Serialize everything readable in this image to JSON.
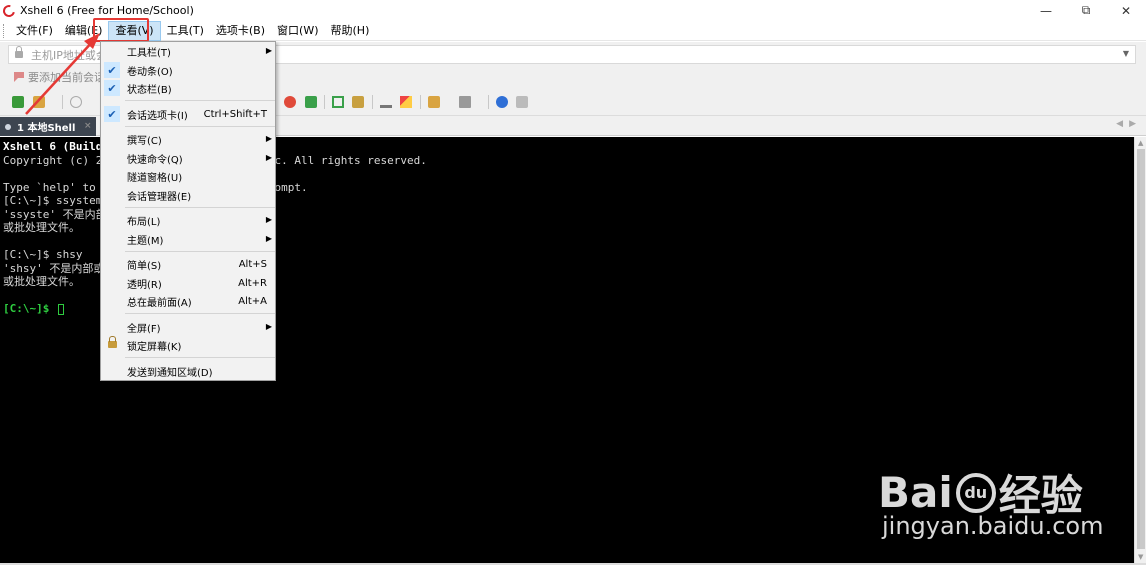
{
  "window": {
    "title": "Xshell 6 (Free for Home/School)",
    "controls": {
      "minimize": "—",
      "maximize": "⧉",
      "close": "✕"
    }
  },
  "menubar": {
    "items": [
      {
        "label": "文件(F)",
        "active": false
      },
      {
        "label": "编辑(E)",
        "active": false
      },
      {
        "label": "查看(V)",
        "active": true
      },
      {
        "label": "工具(T)",
        "active": false
      },
      {
        "label": "选项卡(B)",
        "active": false
      },
      {
        "label": "窗口(W)",
        "active": false
      },
      {
        "label": "帮助(H)",
        "active": false
      }
    ]
  },
  "addressbar": {
    "placeholder": "主机IP地址或会话名称",
    "dropdown_glyph": "▼"
  },
  "hintbar": {
    "text": "要添加当前会话，点击左侧的箭头按钮。"
  },
  "tab": {
    "label": "1 本地Shell",
    "close_glyph": "×",
    "nav_glyph": "◀▶"
  },
  "terminal": {
    "lines": [
      "Xshell 6 (Build 0197)",
      "Copyright (c) 2002 NetSarang Computer, Inc. All rights reserved.",
      "",
      "Type `help' to learn how to use Xshell prompt.",
      "[C:\\~]$ ssystem",
      "'ssyste' 不是内部或外部命令，也不是可运行的程序",
      "或批处理文件。",
      "",
      "[C:\\~]$ shsy",
      "'shsy' 不是内部或外部命令，也不是可运行的程序",
      "或批处理文件。",
      "",
      "[C:\\~]$ "
    ]
  },
  "view_menu": {
    "items": [
      {
        "label": "工具栏(T)",
        "shortcut": "",
        "submenu": true,
        "checked": false
      },
      {
        "label": "卷动条(O)",
        "shortcut": "",
        "submenu": false,
        "checked": true
      },
      {
        "label": "状态栏(B)",
        "shortcut": "",
        "submenu": false,
        "checked": true
      },
      {
        "label": "会话选项卡(I)",
        "shortcut": "Ctrl+Shift+T",
        "submenu": false,
        "checked": true
      },
      {
        "label": "撰写(C)",
        "shortcut": "",
        "submenu": true,
        "checked": false
      },
      {
        "label": "快速命令(Q)",
        "shortcut": "",
        "submenu": true,
        "checked": false
      },
      {
        "label": "隧道窗格(U)",
        "shortcut": "",
        "submenu": false,
        "checked": false
      },
      {
        "label": "会话管理器(E)",
        "shortcut": "",
        "submenu": false,
        "checked": false
      },
      {
        "label": "布局(L)",
        "shortcut": "",
        "submenu": true,
        "checked": false
      },
      {
        "label": "主题(M)",
        "shortcut": "",
        "submenu": true,
        "checked": false
      },
      {
        "label": "简单(S)",
        "shortcut": "Alt+S",
        "submenu": false,
        "checked": false
      },
      {
        "label": "透明(R)",
        "shortcut": "Alt+R",
        "submenu": false,
        "checked": false
      },
      {
        "label": "总在最前面(A)",
        "shortcut": "Alt+A",
        "submenu": false,
        "checked": false
      },
      {
        "label": "全屏(F)",
        "shortcut": "",
        "submenu": true,
        "checked": false
      },
      {
        "label": "锁定屏幕(K)",
        "shortcut": "",
        "submenu": false,
        "checked": false
      },
      {
        "label": "发送到通知区域(D)",
        "shortcut": "",
        "submenu": false,
        "checked": false
      }
    ],
    "check_glyph": "✔",
    "arrow_glyph": "▶"
  },
  "watermark": {
    "brand_left": "Bai",
    "brand_paw": "du",
    "brand_right": "经验",
    "url": "jingyan.baidu.com"
  },
  "colors": {
    "accent_red": "#e53935",
    "terminal_bg": "#000000",
    "prompt_green": "#2ecc40",
    "tab_bg": "#3d4550"
  }
}
